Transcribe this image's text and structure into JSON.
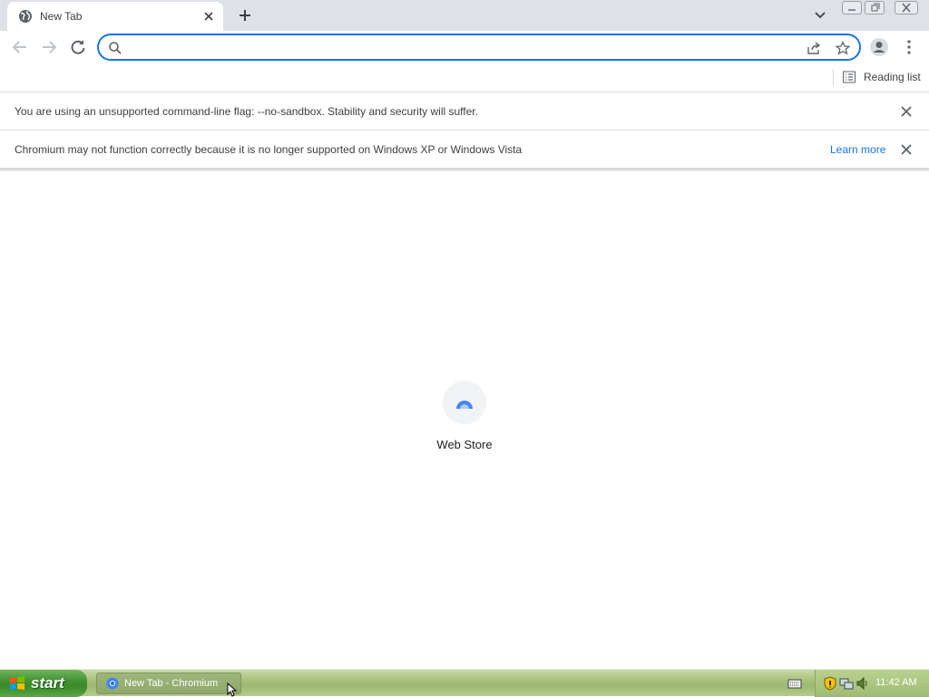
{
  "tab": {
    "title": "New Tab",
    "favicon": "globe-icon"
  },
  "omnibox": {
    "value": "",
    "placeholder": ""
  },
  "bookmarks": {
    "reading_list_label": "Reading list"
  },
  "infobars": [
    {
      "text": "You are using an unsupported command-line flag: --no-sandbox. Stability and security will suffer."
    },
    {
      "text": "Chromium may not function correctly because it is no longer supported on Windows XP or Windows Vista",
      "link": "Learn more"
    }
  ],
  "shortcuts": [
    {
      "label": "Web Store",
      "icon": "web-store-icon"
    }
  ],
  "taskbar": {
    "start_label": "start",
    "task_label": "New Tab - Chromium",
    "clock": "11:42 AM"
  },
  "colors": {
    "accent": "#1a73e8",
    "tabstrip": "#dee1e6",
    "taskbar": "#a8c27c"
  }
}
